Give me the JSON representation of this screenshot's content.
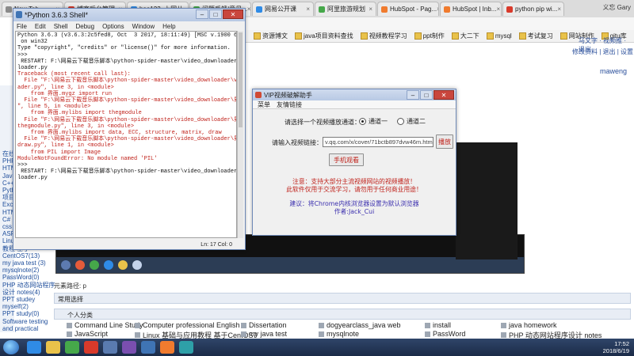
{
  "browser": {
    "tabs": [
      {
        "label": "New Tab",
        "color": "#8a8a8a"
      },
      {
        "label": "博客后台管理",
        "color": "#d93a2b"
      },
      {
        "label": "hao123_上网从...",
        "color": "#2f8be6"
      },
      {
        "label": "问题反馈/意见...",
        "color": "#46a84a"
      },
      {
        "label": "网易公开课",
        "color": "#2f8be6"
      },
      {
        "label": "阿里旅游规划",
        "color": "#46a84a"
      },
      {
        "label": "HubSpot - Pag...",
        "color": "#f07b2e"
      },
      {
        "label": "HubSpot | Inb...",
        "color": "#f07b2e"
      },
      {
        "label": "python pip wi...",
        "color": "#d93a2b"
      }
    ],
    "user_label": "义忘 Gary",
    "bookmarks": [
      "资源博文",
      "java项目资料查找",
      "视频教程学习",
      "ppt制作",
      "大二下",
      "mysql",
      "考试复习",
      "网站制作",
      "gitu库"
    ],
    "page_links_top": "马文字 · 视频推 · 退出",
    "page_links_2": "修改资料 | 退出 | 设置",
    "page_user": "maweng"
  },
  "idle": {
    "title": "*Python 3.6.3 Shell*",
    "menu": [
      "File",
      "Edit",
      "Shell",
      "Debug",
      "Options",
      "Window",
      "Help"
    ],
    "lines": [
      {
        "t": "Python 3.6.3 (v3.6.3:2c5fed8, Oct  3 2017, 18:11:49) [MSC v.1900 64 bit (AMD64)]",
        "c": "blk"
      },
      {
        "t": " on win32",
        "c": "blk"
      },
      {
        "t": "Type \"copyright\", \"credits\" or \"license()\" for more information.",
        "c": "blk"
      },
      {
        "t": ">>> ",
        "c": "blk"
      },
      {
        "t": " RESTART: F:\\网易云下载音乐脚本\\python-spider-master\\video_downloader\\video_down",
        "c": "blk"
      },
      {
        "t": "loader.py",
        "c": "blk"
      },
      {
        "t": "Traceback (most recent call last):",
        "c": "red"
      },
      {
        "t": "  File \"F:\\网易云下载音乐脚本\\python-spider-master\\video_downloader\\video_downlo",
        "c": "red"
      },
      {
        "t": "ader.py\", line 3, in <module>",
        "c": "red"
      },
      {
        "t": "    from 界面.mygz import run",
        "c": "red"
      },
      {
        "t": "  File \"F:\\网易云下载音乐脚本\\python-spider-master\\video_downloader\\界面\\mygz.py",
        "c": "red"
      },
      {
        "t": "\", line 5, in <module>",
        "c": "red"
      },
      {
        "t": "    from 界面.mylibs import thegmodule",
        "c": "red"
      },
      {
        "t": "  File \"F:\\网易云下载音乐脚本\\python-spider-master\\video_downloader\\界面\\mylibs\\",
        "c": "red"
      },
      {
        "t": "thegmodule.py\", line 3, in <module>",
        "c": "red"
      },
      {
        "t": "    from 界面.mylibs import data, ECC, structure, matrix, draw",
        "c": "red"
      },
      {
        "t": "  File \"F:\\网易云下载音乐脚本\\python-spider-master\\video_downloader\\界面\\mylibs\\",
        "c": "red"
      },
      {
        "t": "draw.py\", line 1, in <module>",
        "c": "red"
      },
      {
        "t": "    from PIL import Image",
        "c": "red"
      },
      {
        "t": "ModuleNotFoundError: No module named 'PIL'",
        "c": "red"
      },
      {
        "t": ">>> ",
        "c": "blk"
      },
      {
        "t": " RESTART: F:\\网易云下载音乐脚本\\python-spider-master\\video_downloader\\video_down",
        "c": "blk"
      },
      {
        "t": "loader.py",
        "c": "blk"
      }
    ],
    "status": "Ln: 17  Col: 0"
  },
  "vip": {
    "title": "VIP视频破解助手",
    "menu": [
      "菜单",
      "友情链接"
    ],
    "channel_prompt": "请选择一个视频播放通道：",
    "channel1": "通道一",
    "channel2": "通道二",
    "url_label": "请输入视频链接：",
    "url_value": "v.qq.com/x/cover/71bctb897dvw46m.html",
    "play_button": "播放",
    "mobile_button": "手机观看",
    "notice1": "注意：支持大部分主流视频网站的视频播放！",
    "notice2": "此软件仅用于交流学习，请勿用于任何商业用途！",
    "advice1": "建议：将Chrome内核浏览器设置为默认浏览器",
    "advice2": "作者:Jack_Cui"
  },
  "page": {
    "left_links": [
      "在线编辑",
      "PHP",
      "HTML/C",
      "Java",
      "C++",
      "Pyth",
      "项目",
      "Excel",
      "HTML",
      "C#",
      "css",
      "ASP",
      "Linux 基础与应用",
      "教程 基于",
      "CentOS7(13)",
      "my java test (3)",
      "mysqlnote(2)",
      "PassWord(0)",
      "PHP 动态网站程序",
      "设计 notes(4)",
      "PPT studey",
      "myself(2)",
      "PPT study(0)",
      "Software testing",
      "and practical"
    ],
    "search_label": "元素路径: p",
    "section_common": "常用选择",
    "section_personal": "个人分类",
    "grid": [
      [
        "Command Line Study",
        "Computer professional English",
        "Dissertation",
        "dogyearclass_java web",
        "install",
        "java homework"
      ],
      [
        "JavaScript",
        "Linux 基础与应用教程 基于CentOS7",
        "my java test",
        "mysqlnote",
        "PassWord",
        "PHP 动态网站程序设计 notes"
      ]
    ]
  },
  "taskbar": {
    "time": "17:52",
    "date": "2018/6/19"
  }
}
